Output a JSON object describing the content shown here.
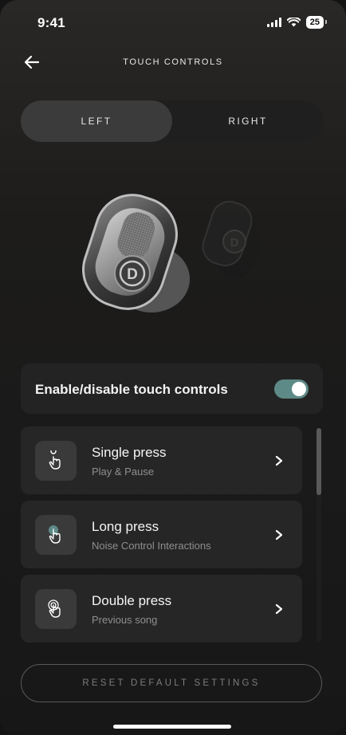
{
  "status_bar": {
    "time": "9:41",
    "battery": "25"
  },
  "header": {
    "title": "TOUCH CONTROLS"
  },
  "side_selector": {
    "options": [
      "LEFT",
      "RIGHT"
    ],
    "selected": "LEFT"
  },
  "touch_toggle": {
    "label": "Enable/disable touch controls",
    "enabled": true
  },
  "gestures": [
    {
      "title": "Single press",
      "subtitle": "Play & Pause",
      "icon": "single-tap-icon"
    },
    {
      "title": "Long press",
      "subtitle": "Noise Control Interactions",
      "icon": "long-press-icon"
    },
    {
      "title": "Double press",
      "subtitle": "Previous song",
      "icon": "double-tap-icon"
    }
  ],
  "reset_label": "RESET DEFAULT SETTINGS",
  "colors": {
    "toggle_on": "#5d8a86",
    "card": "#262626",
    "background": "#1a1a1a"
  }
}
